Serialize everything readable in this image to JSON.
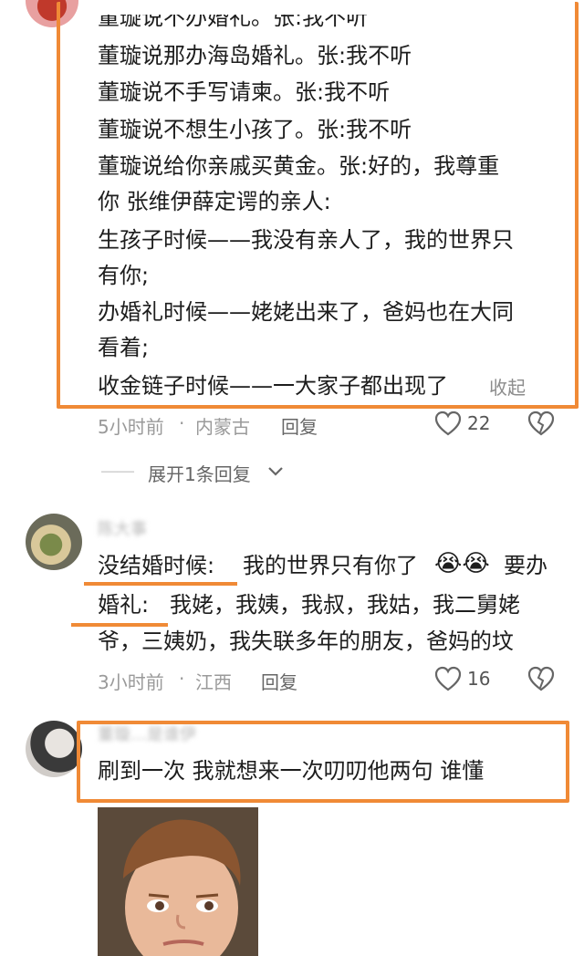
{
  "comment1": {
    "lines": [
      "董璇说不办婚礼。张:我不听",
      "董璇说那办海岛婚礼。张:我不听",
      "董璇说不手写请柬。张:我不听",
      "董璇说不想生小孩了。张:我不听",
      "董璇说给你亲戚买黄金。张:好的，我尊重",
      "你  张维伊薛定谔的亲人:",
      "生孩子时候——我没有亲人了，我的世界只",
      "有你;",
      "办婚礼时候——姥姥出来了，爸妈也在大同",
      "看着;",
      "收金链子时候——一大家子都出现了"
    ],
    "collapse": "收起",
    "time": "5小时前",
    "dot": "·",
    "location": "内蒙古",
    "reply": "回复",
    "likes": "22"
  },
  "expand_replies": {
    "dash": "——",
    "label": "展开1条回复"
  },
  "comment2": {
    "username": "陈大事",
    "line1_prefix": "没结婚时候:",
    "line1_rest": "我的世界只有你了",
    "emoji": "😭😭",
    "line1_suffix": "要办",
    "line2_prefix": "婚礼:",
    "line2_rest": "我姥，我姨，我叔，我姑，我二舅姥",
    "line3": "爷，三姨奶，我失联多年的朋友，爸妈的坟",
    "time": "3小时前",
    "dot": "·",
    "location": "江西",
    "reply": "回复",
    "likes": "16"
  },
  "comment3": {
    "username": "董璇…是谁伊",
    "text": "刷到一次  我就想来一次叨叨他两句  谁懂"
  },
  "colors": {
    "highlight": "#f08a36",
    "text": "#1d1d1d",
    "meta": "#9a9a9a"
  },
  "icons": [
    "heart-icon",
    "broken-heart-icon",
    "chevron-down-icon"
  ]
}
